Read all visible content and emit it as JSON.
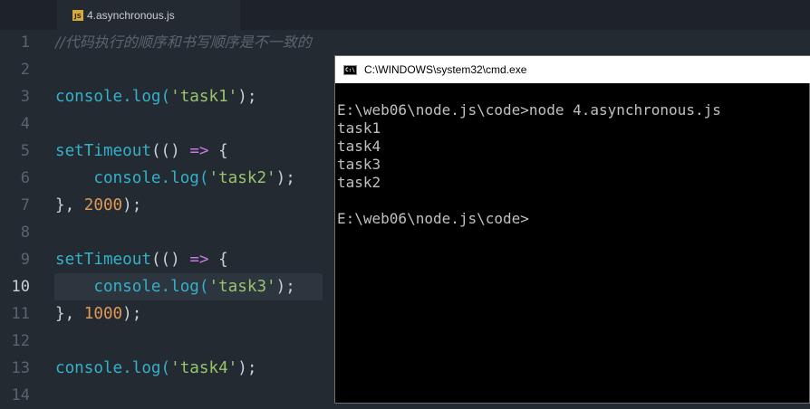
{
  "editor": {
    "tab_title": "4.asynchronous.js",
    "tab_icon": "js-file-icon",
    "tab_icon_text": "JS",
    "active_line": 10,
    "lines": [
      {
        "n": "1",
        "tokens": [
          {
            "t": "//代码执行的顺序和书写顺序是不一致的",
            "c": "k-cmt"
          }
        ]
      },
      {
        "n": "2",
        "tokens": []
      },
      {
        "n": "3",
        "tokens": [
          {
            "t": "console.log(",
            "c": "k-fn"
          },
          {
            "t": "'task1'",
            "c": "k-str"
          },
          {
            "t": ");",
            "c": "k-pun"
          }
        ]
      },
      {
        "n": "4",
        "tokens": []
      },
      {
        "n": "5",
        "tokens": [
          {
            "t": "setTimeout",
            "c": "k-fn"
          },
          {
            "t": "(() ",
            "c": "k-pun"
          },
          {
            "t": "=>",
            "c": "k-op"
          },
          {
            "t": " {",
            "c": "k-pun"
          }
        ]
      },
      {
        "n": "6",
        "tokens": [
          {
            "t": "    console.log(",
            "c": "k-fn"
          },
          {
            "t": "'task2'",
            "c": "k-str"
          },
          {
            "t": ");",
            "c": "k-pun"
          }
        ]
      },
      {
        "n": "7",
        "tokens": [
          {
            "t": "}, ",
            "c": "k-pun"
          },
          {
            "t": "2000",
            "c": "k-num"
          },
          {
            "t": ");",
            "c": "k-pun"
          }
        ]
      },
      {
        "n": "8",
        "tokens": []
      },
      {
        "n": "9",
        "tokens": [
          {
            "t": "setTimeout",
            "c": "k-fn"
          },
          {
            "t": "(() ",
            "c": "k-pun"
          },
          {
            "t": "=>",
            "c": "k-op"
          },
          {
            "t": " {",
            "c": "k-pun"
          }
        ]
      },
      {
        "n": "10",
        "tokens": [
          {
            "t": "    console.log(",
            "c": "k-fn"
          },
          {
            "t": "'task3'",
            "c": "k-str"
          },
          {
            "t": ");",
            "c": "k-pun"
          }
        ]
      },
      {
        "n": "11",
        "tokens": [
          {
            "t": "}, ",
            "c": "k-pun"
          },
          {
            "t": "1000",
            "c": "k-num"
          },
          {
            "t": ");",
            "c": "k-pun"
          }
        ]
      },
      {
        "n": "12",
        "tokens": []
      },
      {
        "n": "13",
        "tokens": [
          {
            "t": "console.log(",
            "c": "k-fn"
          },
          {
            "t": "'task4'",
            "c": "k-str"
          },
          {
            "t": ");",
            "c": "k-pun"
          }
        ]
      },
      {
        "n": "14",
        "tokens": []
      }
    ]
  },
  "cmd": {
    "title": "C:\\WINDOWS\\system32\\cmd.exe",
    "icon": "cmd-icon",
    "icon_text": "C:\\",
    "output": [
      "E:\\web06\\node.js\\code>node 4.asynchronous.js",
      "task1",
      "task4",
      "task3",
      "task2",
      "",
      "E:\\web06\\node.js\\code>"
    ]
  },
  "colors": {
    "editor_bg": "#232a31",
    "function": "#35b0c8",
    "string": "#98c46d",
    "number": "#e09857",
    "operator": "#c678dd",
    "terminal_bg": "#000000",
    "terminal_text": "#c0c0c0"
  }
}
